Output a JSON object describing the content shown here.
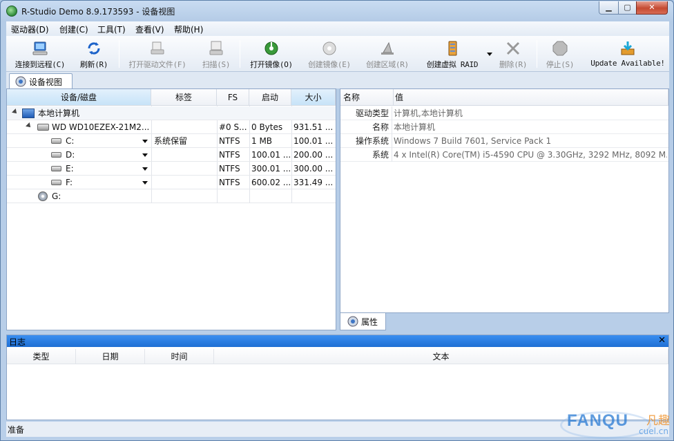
{
  "window": {
    "title": "R-Studio Demo 8.9.173593 - 设备视图",
    "min": "▁",
    "max": "▢",
    "close": "✕"
  },
  "menu": [
    "驱动器(D)",
    "创建(C)",
    "工具(T)",
    "查看(V)",
    "帮助(H)"
  ],
  "toolbar": [
    {
      "label": "连接到远程(C)",
      "icon": "remote-connect-icon",
      "disabled": false
    },
    {
      "label": "刷新(R)",
      "icon": "refresh-icon",
      "disabled": false
    },
    {
      "label": "打开驱动文件(F)",
      "icon": "open-drive-file-icon",
      "disabled": true
    },
    {
      "label": "扫描(S)",
      "icon": "scan-icon",
      "disabled": true
    },
    {
      "label": "打开镜像(O)",
      "icon": "open-image-icon",
      "disabled": false
    },
    {
      "label": "创建镜像(E)",
      "icon": "create-image-icon",
      "disabled": true
    },
    {
      "label": "创建区域(R)",
      "icon": "create-region-icon",
      "disabled": true
    },
    {
      "label": "创建虚拟 RAID",
      "icon": "create-raid-icon",
      "disabled": false
    },
    {
      "label": "删除(R)",
      "icon": "delete-icon",
      "disabled": true
    },
    {
      "label": "停止(S)",
      "icon": "stop-icon",
      "disabled": true
    },
    {
      "label": "Update Available!",
      "icon": "update-icon",
      "disabled": false
    }
  ],
  "tabs": {
    "device_view": "设备视图"
  },
  "device_table": {
    "headers": [
      "设备/磁盘",
      "标签",
      "FS",
      "启动",
      "大小"
    ],
    "rows": [
      {
        "name": "本地计算机",
        "label": "",
        "fs": "",
        "start": "",
        "size": ""
      },
      {
        "name": "WD WD10EZEX-21M2...",
        "label": "",
        "fs": "#0 S...",
        "start": "0 Bytes",
        "size": "931.51 ..."
      },
      {
        "name": "C:",
        "label": "系统保留",
        "fs": "NTFS",
        "start": "1 MB",
        "size": "100.01 ..."
      },
      {
        "name": "D:",
        "label": "",
        "fs": "NTFS",
        "start": "100.01 ...",
        "size": "200.00 ..."
      },
      {
        "name": "E:",
        "label": "",
        "fs": "NTFS",
        "start": "300.01 ...",
        "size": "300.00 ..."
      },
      {
        "name": "F:",
        "label": "",
        "fs": "NTFS",
        "start": "600.02 ...",
        "size": "331.49 ..."
      },
      {
        "name": "G:",
        "label": "",
        "fs": "",
        "start": "",
        "size": ""
      }
    ]
  },
  "properties": {
    "headers": [
      "名称",
      "值"
    ],
    "rows": [
      {
        "key": "驱动类型",
        "value": "计算机,本地计算机"
      },
      {
        "key": "名称",
        "value": "本地计算机"
      },
      {
        "key": "操作系统",
        "value": "Windows 7 Build 7601, Service Pack 1"
      },
      {
        "key": "系统",
        "value": "4 x Intel(R) Core(TM) i5-4590 CPU @ 3.30GHz, 3292 MHz, 8092 M..."
      }
    ],
    "tab": "属性"
  },
  "log": {
    "title": "日志",
    "close": "✕",
    "headers": [
      "类型",
      "日期",
      "时间",
      "文本"
    ]
  },
  "status": "准备",
  "watermark": {
    "brand": "FANQU",
    "cn": "凡趣",
    "domain": "cuel.cn"
  }
}
